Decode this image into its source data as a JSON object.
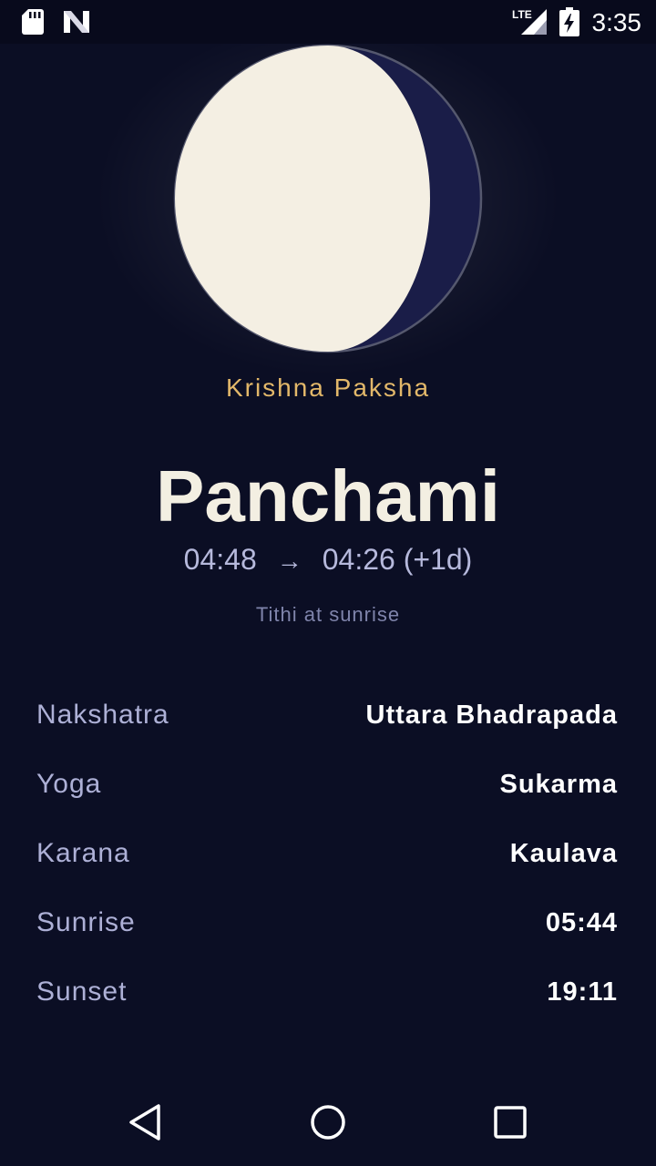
{
  "status_bar": {
    "time": "3:35",
    "network": "LTE",
    "icons": [
      "sd-card-icon",
      "n-notification-icon",
      "lte-signal-icon",
      "battery-charging-icon"
    ]
  },
  "moon": {
    "phase_description": "waning gibbous",
    "colors": {
      "lit": "#f4efe3",
      "shadow": "#1a1d48",
      "rim": "#55586e"
    }
  },
  "paksha": "Krishna Paksha",
  "tithi": {
    "name": "Panchami",
    "start": "04:48",
    "arrow": "→",
    "end": "04:26 (+1d)",
    "note": "Tithi at sunrise"
  },
  "details": [
    {
      "label": "Nakshatra",
      "value": "Uttara Bhadrapada"
    },
    {
      "label": "Yoga",
      "value": "Sukarma"
    },
    {
      "label": "Karana",
      "value": "Kaulava"
    },
    {
      "label": "Sunrise",
      "value": "05:44"
    },
    {
      "label": "Sunset",
      "value": "19:11"
    }
  ],
  "nav_bar": {
    "buttons": [
      "back-icon",
      "home-icon",
      "recents-icon"
    ]
  },
  "colors": {
    "background": "#0b0e24",
    "accent": "#e3b86a",
    "title": "#f3efe2",
    "label": "#adb0d6"
  }
}
